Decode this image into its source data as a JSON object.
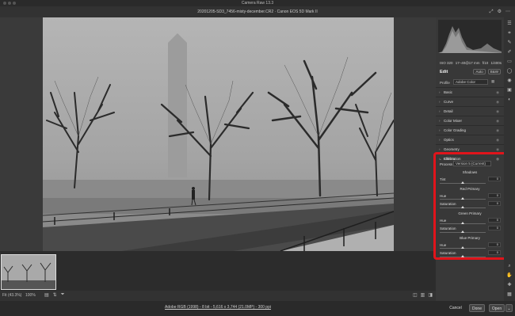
{
  "window": {
    "title": "Camera Raw 13.3"
  },
  "header": {
    "file_title": "20201205-SD3_7456-misty-december.CR2  ·  Canon EOS 5D Mark II"
  },
  "metadata": {
    "iso": "ISO 320",
    "lens": "17–40@17 mm",
    "aperture": "f/10",
    "shutter": "1/400s"
  },
  "edit": {
    "title": "Edit",
    "auto_label": "Auto",
    "bw_label": "B&W",
    "profile_label": "Profile",
    "profile_value": "Adobe Color"
  },
  "sections": [
    "Basic",
    "Curve",
    "Detail",
    "Color Mixer",
    "Color Grading",
    "Optics",
    "Geometry",
    "Effects"
  ],
  "calibration": {
    "title": "Calibration",
    "process_label": "Process",
    "process_value": "Version 5 (Current)",
    "shadows": {
      "title": "Shadows",
      "tint_label": "Tint",
      "tint_value": "0"
    },
    "red": {
      "title": "Red Primary",
      "hue_label": "Hue",
      "hue_value": "0",
      "sat_label": "Saturation",
      "sat_value": "0"
    },
    "green": {
      "title": "Green Primary",
      "hue_label": "Hue",
      "hue_value": "0",
      "sat_label": "Saturation",
      "sat_value": "0"
    },
    "blue": {
      "title": "Blue Primary",
      "hue_label": "Hue",
      "hue_value": "0",
      "sat_label": "Saturation",
      "sat_value": "0"
    }
  },
  "bottom": {
    "zoom_label": "Fit (43.3%)",
    "zoom_value": "100%"
  },
  "footer": {
    "file_info": "Adobe RGB (1998) - 8 bit - 5,616 x 3,744 (21.0MP) - 300 ppi",
    "cancel": "Cancel",
    "done": "Done",
    "open": "Open"
  },
  "colors": {
    "highlight": "#e0141b",
    "panel": "#383838",
    "background": "#323232"
  }
}
